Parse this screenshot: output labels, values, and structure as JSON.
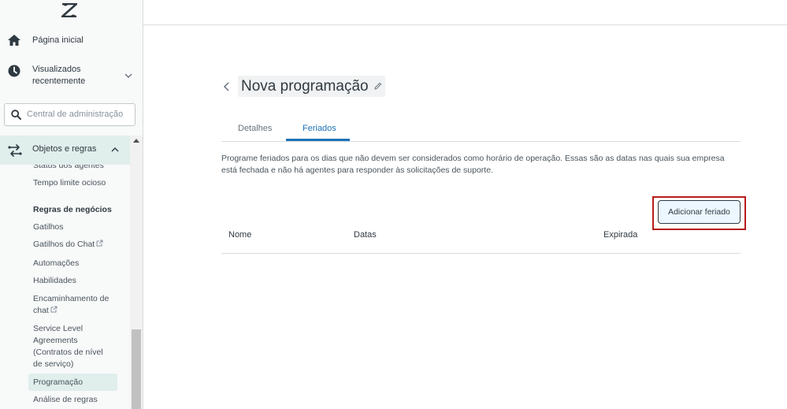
{
  "sidebar": {
    "nav": {
      "home_label": "Página inicial",
      "recent_label_line1": "Visualizados",
      "recent_label_line2": "recentemente"
    },
    "search": {
      "placeholder": "Central de administração"
    },
    "section": {
      "label": "Objetos e regras",
      "items": {
        "partial_label": "Status dos agentes",
        "idle_timeout": "Tempo limite ocioso",
        "business_rules_heading": "Regras de negócios",
        "triggers": "Gatilhos",
        "chat_triggers": "Gatilhos do Chat",
        "automations": "Automações",
        "skills": "Habilidades",
        "chat_routing_line1": "Encaminhamento de",
        "chat_routing_line2": "chat",
        "sla_line1": "Service Level",
        "sla_line2": "Agreements",
        "sla_line3": "(Contratos de nível",
        "sla_line4": "de serviço)",
        "schedules": "Programação",
        "rules_analysis": "Análise de regras"
      }
    },
    "colors": {
      "active_bg": "#e0eeec"
    }
  },
  "page": {
    "title": "Nova programação",
    "tabs": [
      "Detalhes",
      "Feriados"
    ],
    "active_tab": "Feriados",
    "description": "Programe feriados para os dias que não devem ser considerados como horário de operação. Essas são as datas nas quais sua empresa está fechada e não há agentes para responder às solicitações de suporte.",
    "add_button": "Adicionar feriado",
    "table": {
      "columns": [
        "Nome",
        "Datas",
        "Expirada"
      ]
    }
  },
  "icons": [
    "zendesk-logo",
    "home-icon",
    "clock-icon",
    "chevron-down-icon",
    "search-icon",
    "objects-rules-icon",
    "chevron-up-icon",
    "external-link-icon",
    "back-chevron-icon",
    "pencil-icon"
  ]
}
